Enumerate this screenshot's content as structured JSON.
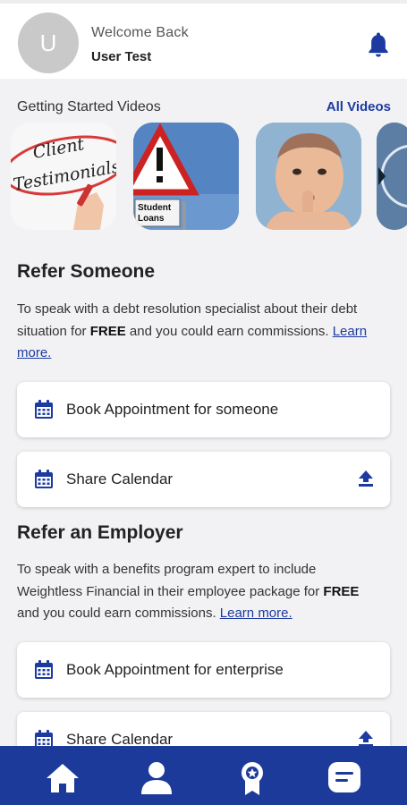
{
  "header": {
    "avatar_initial": "U",
    "welcome_text": "Welcome Back",
    "user_name": "User Test",
    "notification_icon": "bell-icon"
  },
  "videos": {
    "title": "Getting Started Videos",
    "all_link": "All Videos",
    "thumbnails": [
      {
        "label": "Client Testimonials"
      },
      {
        "label": "Student Loans"
      },
      {
        "label": "baby thumbnail"
      },
      {
        "label": "partial thumbnail"
      }
    ]
  },
  "refer_someone": {
    "title": "Refer Someone",
    "desc_part1": "To speak with a debt resolution specialist about their debt situation for ",
    "desc_bold": "FREE",
    "desc_part2": " and you could earn commissions. ",
    "learn_more": "Learn more.",
    "book_label": "Book Appointment for someone",
    "share_label": "Share Calendar"
  },
  "refer_employer": {
    "title": "Refer an Employer",
    "desc_part1": "To speak with a benefits program expert to include Weightless Financial in their employee package for ",
    "desc_bold": "FREE",
    "desc_part2": " and you could earn commissions. ",
    "learn_more": "Learn more.",
    "book_label": "Book Appointment for enterprise",
    "share_label": "Share Calendar"
  },
  "colors": {
    "accent": "#1c3aa0",
    "nav_bg": "#1b3a9a",
    "avatar_bg": "#c9c9c9",
    "page_bg": "#f2f2f4"
  },
  "bottom_nav": {
    "items": [
      "home-icon",
      "profile-icon",
      "rewards-badge-icon",
      "chat-icon"
    ]
  }
}
